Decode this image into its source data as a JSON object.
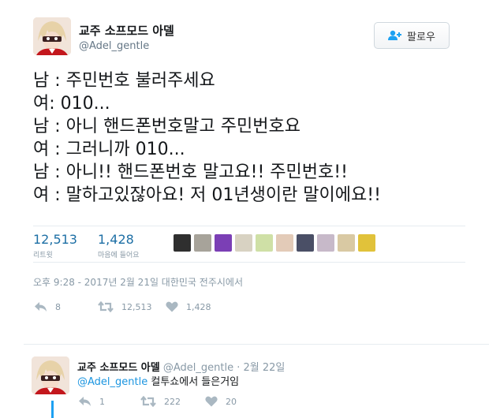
{
  "tweet": {
    "author_name": "교주 소프모드 아델",
    "author_handle": "@Adel_gentle",
    "follow_label": "팔로우",
    "lines": [
      "남 : 주민번호 불러주세요",
      "여: 010...",
      "남 : 아니 핸드폰번호말고 주민번호요",
      "여 : 그러니까 010...",
      "남 : 아니!! 핸드폰번호 말고요!! 주민번호!!",
      "여 : 말하고있잖아요! 저 01년생이란 말이에요!!"
    ],
    "retweets_count": "12,513",
    "retweets_label": "리트윗",
    "likes_count": "1,428",
    "likes_label": "마음에 들어요",
    "liker_avatar_colors": [
      "#2f2f2f",
      "#a7a39a",
      "#7b3fb5",
      "#d8d2c2",
      "#cfe0a6",
      "#e3cbb8",
      "#4a4f66",
      "#c7b9c9",
      "#d9c9a3",
      "#e1c23a"
    ],
    "timestamp": "오후 9:28 - 2017년 2월 21일 대한민국 전주시에서",
    "actions": {
      "reply": "8",
      "retweet": "12,513",
      "like": "1,428"
    }
  },
  "reply": {
    "author_name": "교주 소프모드 아델",
    "author_handle": "@Adel_gentle",
    "date": "· 2월 22일",
    "mention": "@Adel_gentle",
    "text": "컬투쇼에서 들은거임",
    "actions": {
      "reply": "1",
      "retweet": "222",
      "like": "20"
    }
  },
  "colors": {
    "link": "#1b95e0",
    "muted": "#8899a6",
    "accent": "#1da1f2"
  },
  "icons": [
    "add-user-icon",
    "reply-icon",
    "retweet-icon",
    "heart-icon"
  ]
}
